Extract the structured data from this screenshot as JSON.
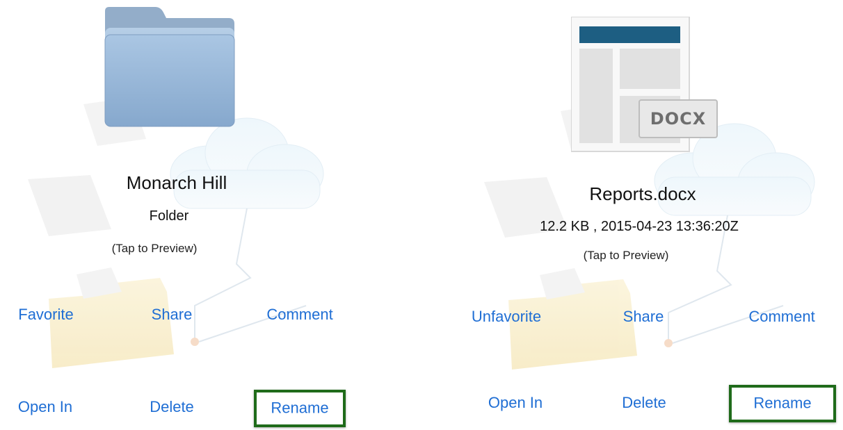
{
  "left": {
    "name": "Monarch Hill",
    "kind": "Folder",
    "hint": "(Tap to Preview)",
    "actions": {
      "favorite": "Favorite",
      "share": "Share",
      "comment": "Comment",
      "open_in": "Open In",
      "delete": "Delete",
      "rename": "Rename"
    },
    "icon": "folder-icon"
  },
  "right": {
    "name": "Reports.docx",
    "meta": "12.2 KB , 2015-04-23 13:36:20Z",
    "hint": "(Tap to Preview)",
    "badge": "DOCX",
    "actions": {
      "favorite": "Unfavorite",
      "share": "Share",
      "comment": "Comment",
      "open_in": "Open In",
      "delete": "Delete",
      "rename": "Rename"
    },
    "icon": "docx-document-icon"
  },
  "colors": {
    "action": "#1f6ed4",
    "highlight": "#1f6b1a"
  }
}
